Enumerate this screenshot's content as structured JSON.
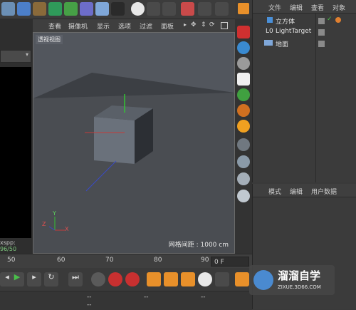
{
  "viewport": {
    "menu": [
      "查看",
      "摄像机",
      "显示",
      "选项",
      "过滤",
      "面板"
    ],
    "label": "透视视图",
    "grid_spacing": "网格间距 : 1000 cm",
    "axis": {
      "y": "Y",
      "x": "X",
      "z": "Z"
    }
  },
  "left_panel": {
    "status_prefix": "xspp:",
    "status_value": "96/50"
  },
  "object_manager": {
    "menu": [
      "文件",
      "编辑",
      "查看",
      "对象"
    ],
    "objects": [
      {
        "name": "立方体",
        "icon": "cube-icon"
      },
      {
        "name": "LightTarget",
        "icon": "light-target-icon"
      },
      {
        "name": "地面",
        "icon": "floor-icon"
      }
    ]
  },
  "attribute_manager": {
    "menu": [
      "模式",
      "编辑",
      "用户数据"
    ]
  },
  "timeline": {
    "ticks": [
      "50",
      "60",
      "70",
      "80",
      "90"
    ],
    "frame_field": "0 F"
  },
  "bottom": {
    "fields": [
      "--",
      "--",
      "--",
      "--"
    ]
  },
  "watermark": {
    "title": "溜溜自学",
    "url": "ZIXUE.3D66.COM"
  }
}
